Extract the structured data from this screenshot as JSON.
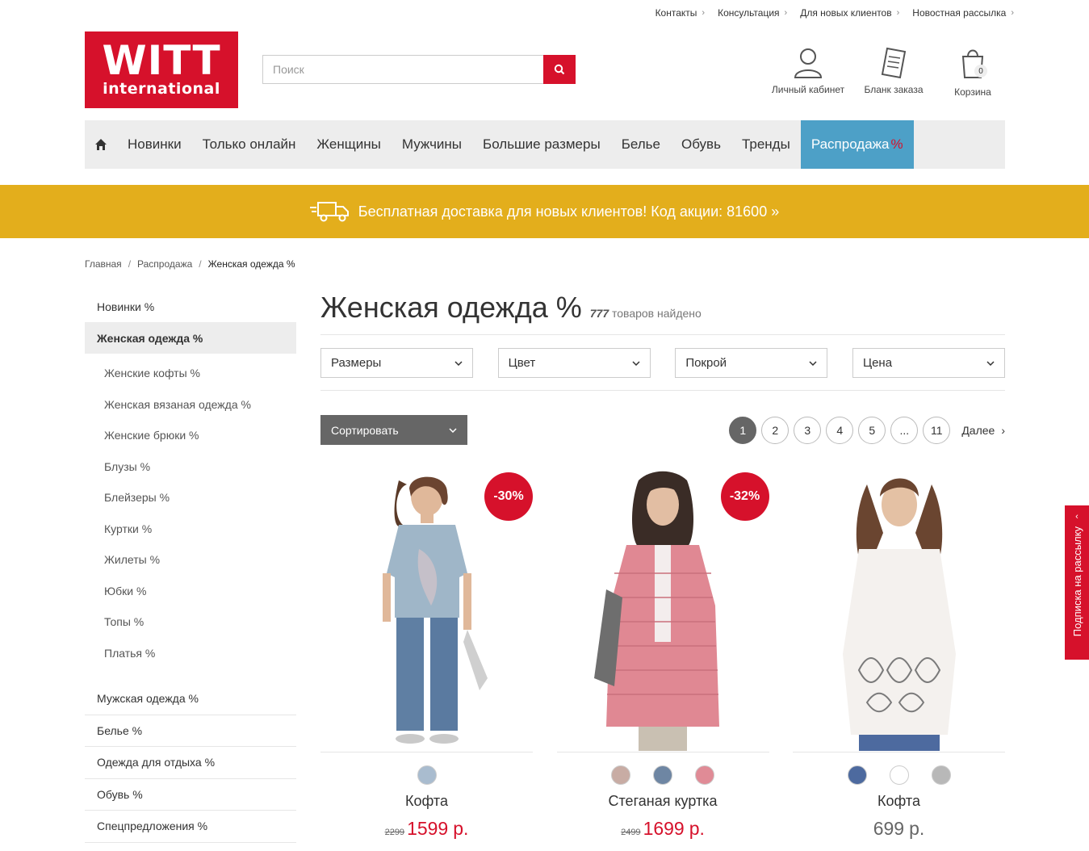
{
  "top_links": [
    "Контакты",
    "Консультация",
    "Для новых клиентов",
    "Новостная рассылка"
  ],
  "logo": {
    "line1": "WITT",
    "line2": "international"
  },
  "search": {
    "placeholder": "Поиск",
    "value": ""
  },
  "header_icons": {
    "account": "Личный кабинет",
    "order_form": "Бланк заказа",
    "cart": "Корзина",
    "cart_count": "0"
  },
  "nav": {
    "items": [
      "Новинки",
      "Только онлайн",
      "Женщины",
      "Мужчины",
      "Большие размеры",
      "Белье",
      "Обувь",
      "Тренды"
    ],
    "sale_label": "Распродажа",
    "sale_pct": "%"
  },
  "promo": {
    "text": "Бесплатная доставка для новых клиентов! Код акции: 81600 »"
  },
  "breadcrumbs": [
    "Главная",
    "Распродажа",
    "Женская одежда %"
  ],
  "sidebar": {
    "top": [
      "Новинки %",
      "Женская одежда %"
    ],
    "subcategories": [
      "Женские кофты %",
      "Женская вязаная одежда %",
      "Женские брюки %",
      "Блузы %",
      "Блейзеры %",
      "Куртки %",
      "Жилеты %",
      "Юбки %",
      "Топы %",
      "Платья %"
    ],
    "bottom": [
      "Мужская одежда %",
      "Белье %",
      "Одежда для отдыха %",
      "Обувь %",
      "Спецпредложения %"
    ]
  },
  "page": {
    "title": "Женская одежда %",
    "count": "777",
    "count_suffix": "товаров найдено"
  },
  "filters": [
    "Размеры",
    "Цвет",
    "Покрой",
    "Цена"
  ],
  "sort_label": "Сортировать",
  "pagination": {
    "pages": [
      "1",
      "2",
      "3",
      "4",
      "5",
      "...",
      "11"
    ],
    "current": "1",
    "next": "Далее"
  },
  "products": [
    {
      "name": "Кофта",
      "badge": "-30%",
      "old_price": "2299",
      "price": "1599",
      "currency": "р.",
      "swatches": [
        "#a9bccf"
      ]
    },
    {
      "name": "Стеганая куртка",
      "badge": "-32%",
      "old_price": "2499",
      "price": "1699",
      "currency": "р.",
      "swatches": [
        "#c8aca4",
        "#6e86a3",
        "#e08b96"
      ]
    },
    {
      "name": "Кофта",
      "badge": "",
      "old_price": "",
      "price": "699",
      "currency": "р.",
      "swatches": [
        "#4d6a9f",
        "#ffffff",
        "#b8b8b8"
      ]
    }
  ],
  "newsletter_tab": "Подписка на рассылку",
  "colors": {
    "brand_red": "#d6112b",
    "promo_yellow": "#e3ae1c",
    "sale_blue": "#4da0c7"
  }
}
